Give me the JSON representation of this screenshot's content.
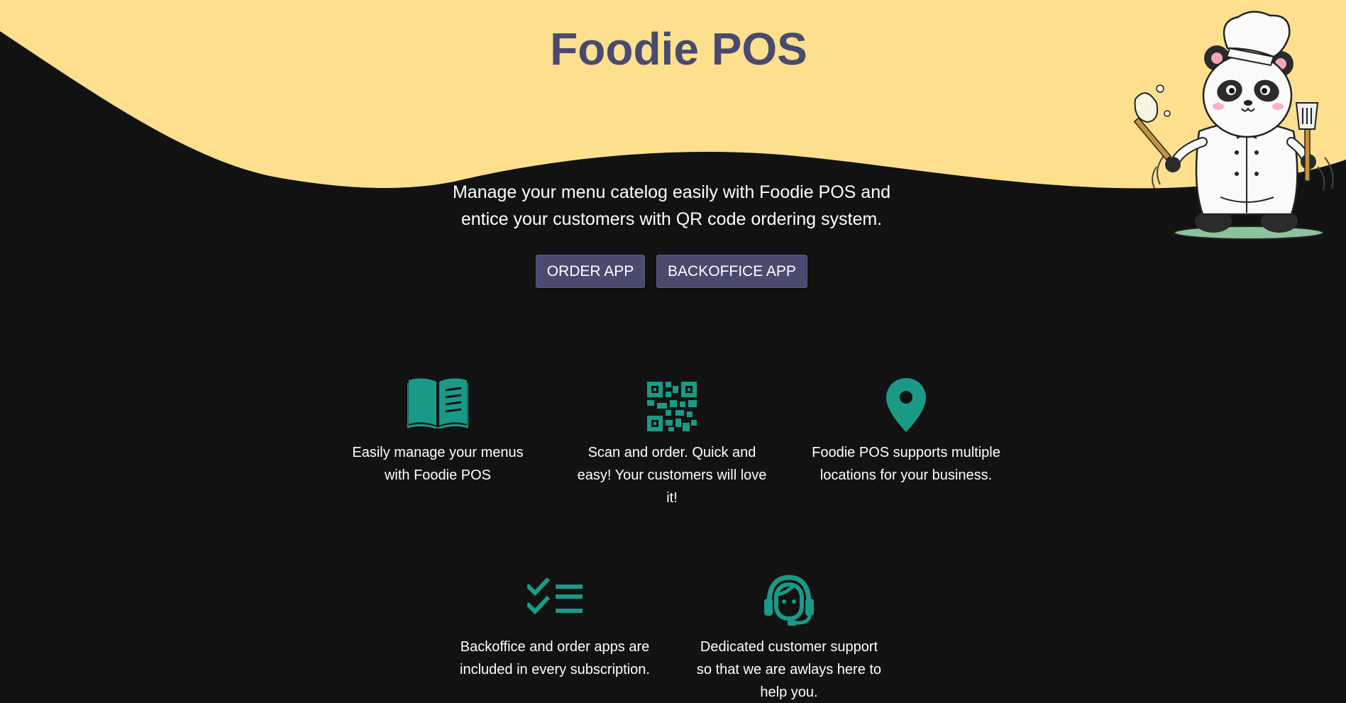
{
  "header": {
    "title": "Foodie POS"
  },
  "hero": {
    "tagline_line1": "Manage your menu catelog easily with Foodie POS and",
    "tagline_line2": "entice your customers with QR code ordering system.",
    "buttons": {
      "order_label": "ORDER APP",
      "backoffice_label": "BACKOFFICE APP"
    }
  },
  "features": [
    {
      "icon": "open-book-icon",
      "text": "Easily manage your menus with Foodie POS"
    },
    {
      "icon": "qr-code-icon",
      "text": "Scan and order. Quick and easy! Your customers will love it!"
    },
    {
      "icon": "location-pin-icon",
      "text": "Foodie POS supports multiple locations for your business."
    },
    {
      "icon": "checklist-icon",
      "text": "Backoffice and order apps are included in every subscription."
    },
    {
      "icon": "headset-support-icon",
      "text": "Dedicated customer support so that we are awlays here to help you."
    }
  ],
  "colors": {
    "background": "#121212",
    "wave": "#ffe08f",
    "title": "#4a4a6e",
    "button": "#4a4a6e",
    "icon": "#1a9a86",
    "text": "#ffffff"
  },
  "mascot": {
    "icon": "panda-chef-illustration"
  }
}
